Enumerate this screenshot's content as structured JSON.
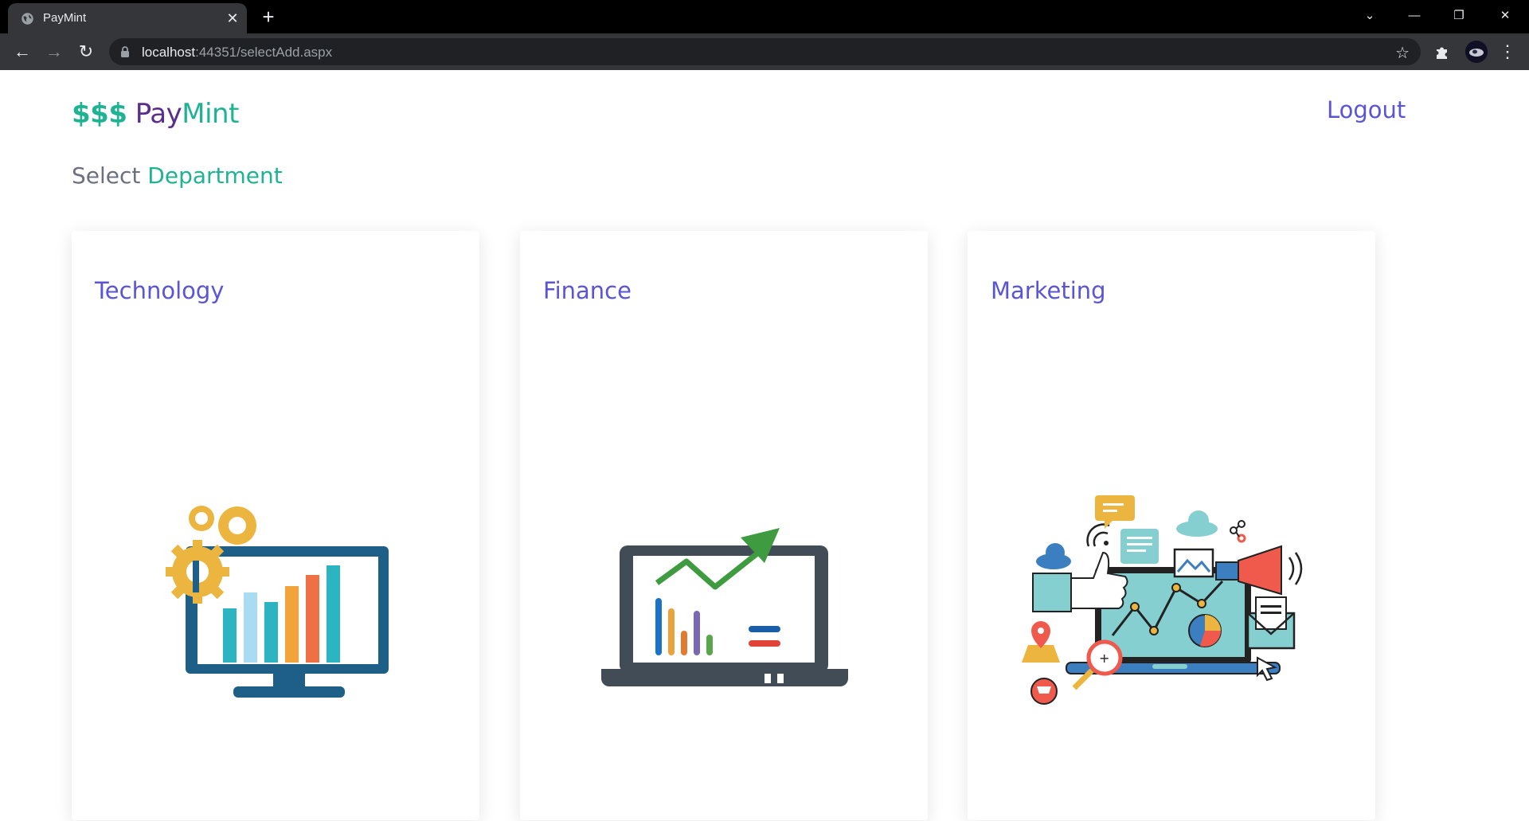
{
  "browser": {
    "tab_title": "PayMint",
    "url_host": "localhost",
    "url_rest": ":44351/selectAdd.aspx"
  },
  "header": {
    "brand_dollars": "$$$",
    "brand_pay": "Pay",
    "brand_mint": "Mint",
    "logout_label": "Logout"
  },
  "heading": {
    "prefix": "Select",
    "highlight": "Department"
  },
  "departments": [
    {
      "label": "Technology",
      "icon": "computer-analytics-icon"
    },
    {
      "label": "Finance",
      "icon": "laptop-growth-chart-icon"
    },
    {
      "label": "Marketing",
      "icon": "digital-marketing-icon"
    }
  ],
  "colors": {
    "brand_green": "#1fb393",
    "brand_purple": "#5b2d8c",
    "link_indigo": "#5a55d6"
  }
}
